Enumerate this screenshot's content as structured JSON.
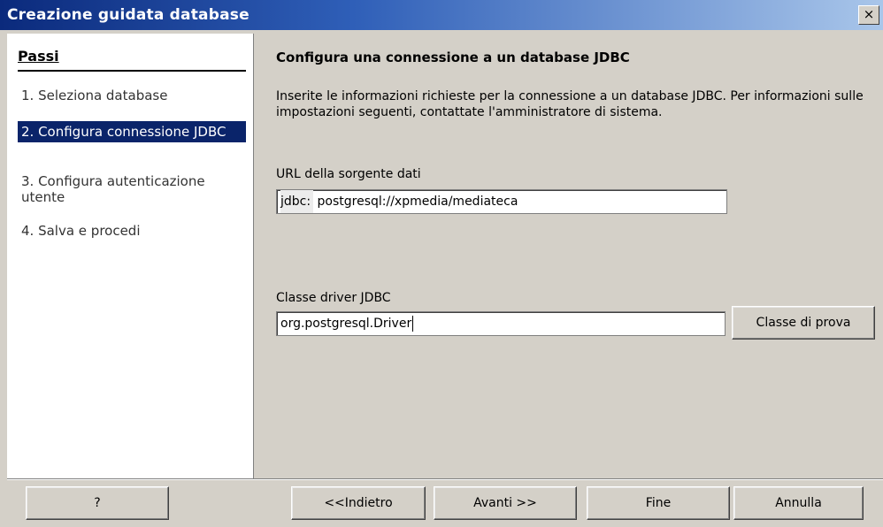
{
  "window": {
    "title": "Creazione guidata database",
    "close_label": "×"
  },
  "steps": {
    "header": "Passi",
    "items": [
      {
        "label": "1. Seleziona database",
        "active": false
      },
      {
        "label": "2. Configura connessione JDBC",
        "active": true
      },
      {
        "label": "3. Configura autenticazione utente",
        "active": false
      },
      {
        "label": "4. Salva e procedi",
        "active": false
      }
    ]
  },
  "main": {
    "heading": "Configura una connessione a un database JDBC",
    "description": "Inserite le informazioni richieste per la connessione a un database JDBC. Per informazioni sulle impostazioni seguenti, contattate l'amministratore di sistema.",
    "url_label": "URL della sorgente dati",
    "url_prefix": "jdbc:",
    "url_value": "postgresql://xpmedia/mediateca",
    "driver_label": "Classe driver JDBC",
    "driver_value": "org.postgresql.Driver",
    "test_class_button": "Classe di prova"
  },
  "footer": {
    "help_button": "?",
    "back_button": "<<Indietro",
    "next_button": "Avanti >>",
    "finish_button": "Fine",
    "cancel_button": "Annulla"
  },
  "colors": {
    "title_gradient_start": "#0b2a7c",
    "selection": "#0a246a",
    "dialog_bg": "#d4d0c8"
  }
}
